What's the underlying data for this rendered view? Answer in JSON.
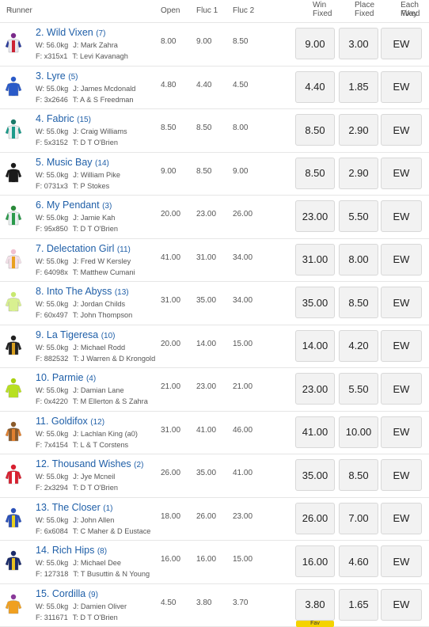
{
  "header": {
    "runner": "Runner",
    "open": "Open",
    "fluc1": "Fluc 1",
    "fluc2": "Fluc 2",
    "win_line1": "Win",
    "win_line2": "Fixed",
    "place_line1": "Place",
    "place_line2": "Fixed",
    "ew_line1": "Each Way",
    "ew_line2": "Fixed",
    "sort_icon": "⇕"
  },
  "runners": [
    {
      "name": "2. Wild Vixen",
      "barrier": "(7)",
      "w": "W: 56.0kg",
      "j": "J: Mark Zahra",
      "f": "F: x315x1",
      "t": "T: Levi Kavanagh",
      "open": "8.00",
      "f1": "9.00",
      "f2": "8.50",
      "win": "9.00",
      "place": "3.00",
      "ew": "EW",
      "silk": {
        "body": "#e8e8f0",
        "stripe": "#cc2233",
        "cap": "#7a2a8a",
        "sleeve": "#2a3a9a"
      }
    },
    {
      "name": "3. Lyre",
      "barrier": "(5)",
      "w": "W: 55.0kg",
      "j": "J: James Mcdonald",
      "f": "F: 3x2646",
      "t": "T: A & S Freedman",
      "open": "4.80",
      "f1": "4.40",
      "f2": "4.50",
      "win": "4.40",
      "place": "1.85",
      "ew": "EW",
      "silk": {
        "body": "#2a5ac8",
        "stripe": "#2a5ac8",
        "cap": "#2a5ac8",
        "sleeve": "#2a5ac8"
      }
    },
    {
      "name": "4. Fabric",
      "barrier": "(15)",
      "w": "W: 55.0kg",
      "j": "J: Craig Williams",
      "f": "F: 5x3152",
      "t": "T: D T O'Brien",
      "open": "8.50",
      "f1": "8.50",
      "f2": "8.00",
      "win": "8.50",
      "place": "2.90",
      "ew": "EW",
      "silk": {
        "body": "#e8f0f0",
        "stripe": "#1a9a8a",
        "cap": "#1a7a6a",
        "sleeve": "#1a9a8a"
      }
    },
    {
      "name": "5. Music Bay",
      "barrier": "(14)",
      "w": "W: 55.0kg",
      "j": "J: William Pike",
      "f": "F: 0731x3",
      "t": "T: P Stokes",
      "open": "9.00",
      "f1": "8.50",
      "f2": "9.00",
      "win": "8.50",
      "place": "2.90",
      "ew": "EW",
      "silk": {
        "body": "#1a1a1a",
        "stripe": "#1a1a1a",
        "cap": "#1a1a1a",
        "sleeve": "#1a1a1a"
      }
    },
    {
      "name": "6. My Pendant",
      "barrier": "(3)",
      "w": "W: 55.0kg",
      "j": "J: Jamie Kah",
      "f": "F: 95x850",
      "t": "T: D T O'Brien",
      "open": "20.00",
      "f1": "23.00",
      "f2": "26.00",
      "win": "23.00",
      "place": "5.50",
      "ew": "EW",
      "silk": {
        "body": "#e8f0f0",
        "stripe": "#2a9a4a",
        "cap": "#2a8a3a",
        "sleeve": "#2a9a4a"
      }
    },
    {
      "name": "7. Delectation Girl",
      "barrier": "(11)",
      "w": "W: 55.0kg",
      "j": "J: Fred W Kersley",
      "f": "F: 64098x",
      "t": "T: Matthew Cumani",
      "open": "41.00",
      "f1": "31.00",
      "f2": "34.00",
      "win": "31.00",
      "place": "8.00",
      "ew": "EW",
      "silk": {
        "body": "#f4e0e8",
        "stripe": "#e8a020",
        "cap": "#f0c0d0",
        "sleeve": "#f4e0e8"
      }
    },
    {
      "name": "8. Into The Abyss",
      "barrier": "(13)",
      "w": "W: 55.0kg",
      "j": "J: Jordan Childs",
      "f": "F: 60x497",
      "t": "T: John Thompson",
      "open": "31.00",
      "f1": "35.00",
      "f2": "34.00",
      "win": "35.00",
      "place": "8.50",
      "ew": "EW",
      "silk": {
        "body": "#d8f090",
        "stripe": "#d8f090",
        "cap": "#c8e870",
        "sleeve": "#d8f090"
      }
    },
    {
      "name": "9. La Tigeresa",
      "barrier": "(10)",
      "w": "W: 55.0kg",
      "j": "J: Michael Rodd",
      "f": "F: 882532",
      "t": "T: J Warren & D Krongold",
      "open": "20.00",
      "f1": "14.00",
      "f2": "15.00",
      "win": "14.00",
      "place": "4.20",
      "ew": "EW",
      "silk": {
        "body": "#222222",
        "stripe": "#d8a020",
        "cap": "#222222",
        "sleeve": "#222222"
      }
    },
    {
      "name": "10. Parmie",
      "barrier": "(4)",
      "w": "W: 55.0kg",
      "j": "J: Damian Lane",
      "f": "F: 0x4220",
      "t": "T: M Ellerton & S Zahra",
      "open": "21.00",
      "f1": "23.00",
      "f2": "21.00",
      "win": "23.00",
      "place": "5.50",
      "ew": "EW",
      "silk": {
        "body": "#b8e020",
        "stripe": "#b8e020",
        "cap": "#a8d010",
        "sleeve": "#b8e020"
      }
    },
    {
      "name": "11. Goldifox",
      "barrier": "(12)",
      "w": "W: 55.0kg",
      "j": "J: Lachlan King (a0)",
      "f": "F: 7x4154",
      "t": "T: L & T Corstens",
      "open": "31.00",
      "f1": "41.00",
      "f2": "46.00",
      "win": "41.00",
      "place": "10.00",
      "ew": "EW",
      "silk": {
        "body": "#8a5a2a",
        "stripe": "#e08030",
        "cap": "#8a5a2a",
        "sleeve": "#e08030"
      }
    },
    {
      "name": "12. Thousand Wishes",
      "barrier": "(2)",
      "w": "W: 55.0kg",
      "j": "J: Jye Mcneil",
      "f": "F: 2x3294",
      "t": "T: D T O'Brien",
      "open": "26.00",
      "f1": "35.00",
      "f2": "41.00",
      "win": "35.00",
      "place": "8.50",
      "ew": "EW",
      "silk": {
        "body": "#d82030",
        "stripe": "#ffffff",
        "cap": "#d82030",
        "sleeve": "#d82030"
      }
    },
    {
      "name": "13. The Closer",
      "barrier": "(1)",
      "w": "W: 55.0kg",
      "j": "J: John Allen",
      "f": "F: 6x6084",
      "t": "T: C Maher & D Eustace",
      "open": "18.00",
      "f1": "26.00",
      "f2": "23.00",
      "win": "26.00",
      "place": "7.00",
      "ew": "EW",
      "silk": {
        "body": "#2a50b8",
        "stripe": "#e8d020",
        "cap": "#2a50b8",
        "sleeve": "#2a50b8"
      }
    },
    {
      "name": "14. Rich Hips",
      "barrier": "(8)",
      "w": "W: 55.0kg",
      "j": "J: Michael Dee",
      "f": "F: 127318",
      "t": "T: T Busuttin & N Young",
      "open": "16.00",
      "f1": "16.00",
      "f2": "15.00",
      "win": "16.00",
      "place": "4.60",
      "ew": "EW",
      "silk": {
        "body": "#1a2a6a",
        "stripe": "#e8c020",
        "cap": "#1a2a6a",
        "sleeve": "#1a2a6a"
      }
    },
    {
      "name": "15. Cordilla",
      "barrier": "(9)",
      "w": "W: 55.0kg",
      "j": "J: Damien Oliver",
      "f": "F: 311671",
      "t": "T: D T O'Brien",
      "open": "4.50",
      "f1": "3.80",
      "f2": "3.70",
      "win": "3.80",
      "place": "1.65",
      "ew": "EW",
      "fav": "Fav",
      "silk": {
        "body": "#f0a020",
        "stripe": "#f0a020",
        "cap": "#8a3a9a",
        "sleeve": "#f0a020"
      }
    }
  ]
}
